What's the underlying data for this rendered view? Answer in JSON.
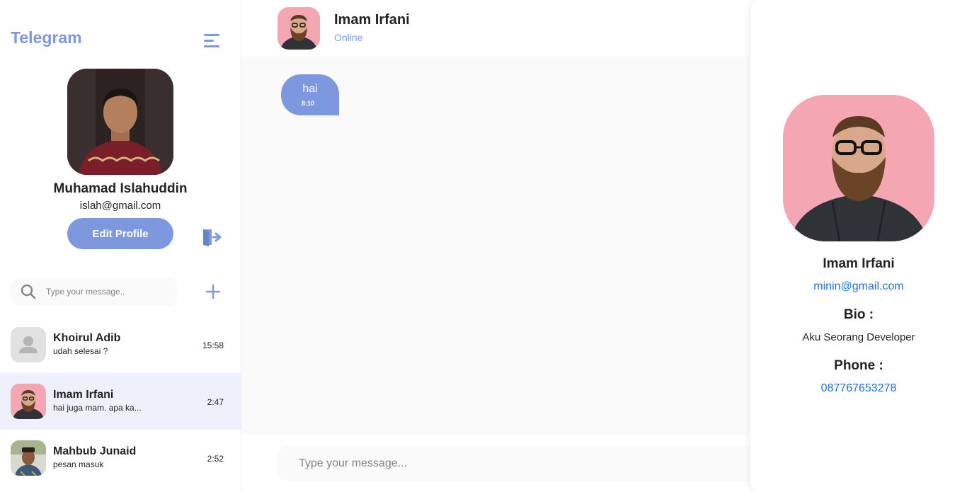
{
  "sidebar": {
    "brand": "Telegram",
    "profile": {
      "name": "Muhamad Islahuddin",
      "email": "islah@gmail.com",
      "edit_label": "Edit Profile"
    },
    "search": {
      "placeholder": "Type your message.."
    },
    "chats": [
      {
        "name": "Khoirul Adib",
        "preview": "udah selesai ?",
        "time": "15:58",
        "avatar": "placeholder-user-icon"
      },
      {
        "name": "Imam Irfani",
        "preview": "hai juga mam. apa ka...",
        "time": "2:47",
        "avatar": "bearded-man-pink"
      },
      {
        "name": "Mahbub Junaid",
        "preview": "pesan masuk",
        "time": "2:52",
        "avatar": "man-with-cap"
      }
    ]
  },
  "chat": {
    "name": "Imam Irfani",
    "status": "Online",
    "messages": [
      {
        "text": "hai",
        "time": "8:10"
      }
    ],
    "input_placeholder": "Type your message..."
  },
  "contact_profile": {
    "name": "Imam Irfani",
    "email": "minin@gmail.com",
    "bio_heading": "Bio :",
    "bio": "Aku Seorang Developer",
    "phone_heading": "Phone :",
    "phone": "087767653278"
  },
  "colors": {
    "accent": "#7e98df",
    "link": "#1e70d8",
    "active_row": "#eef1fc",
    "background": "#fafafa"
  }
}
